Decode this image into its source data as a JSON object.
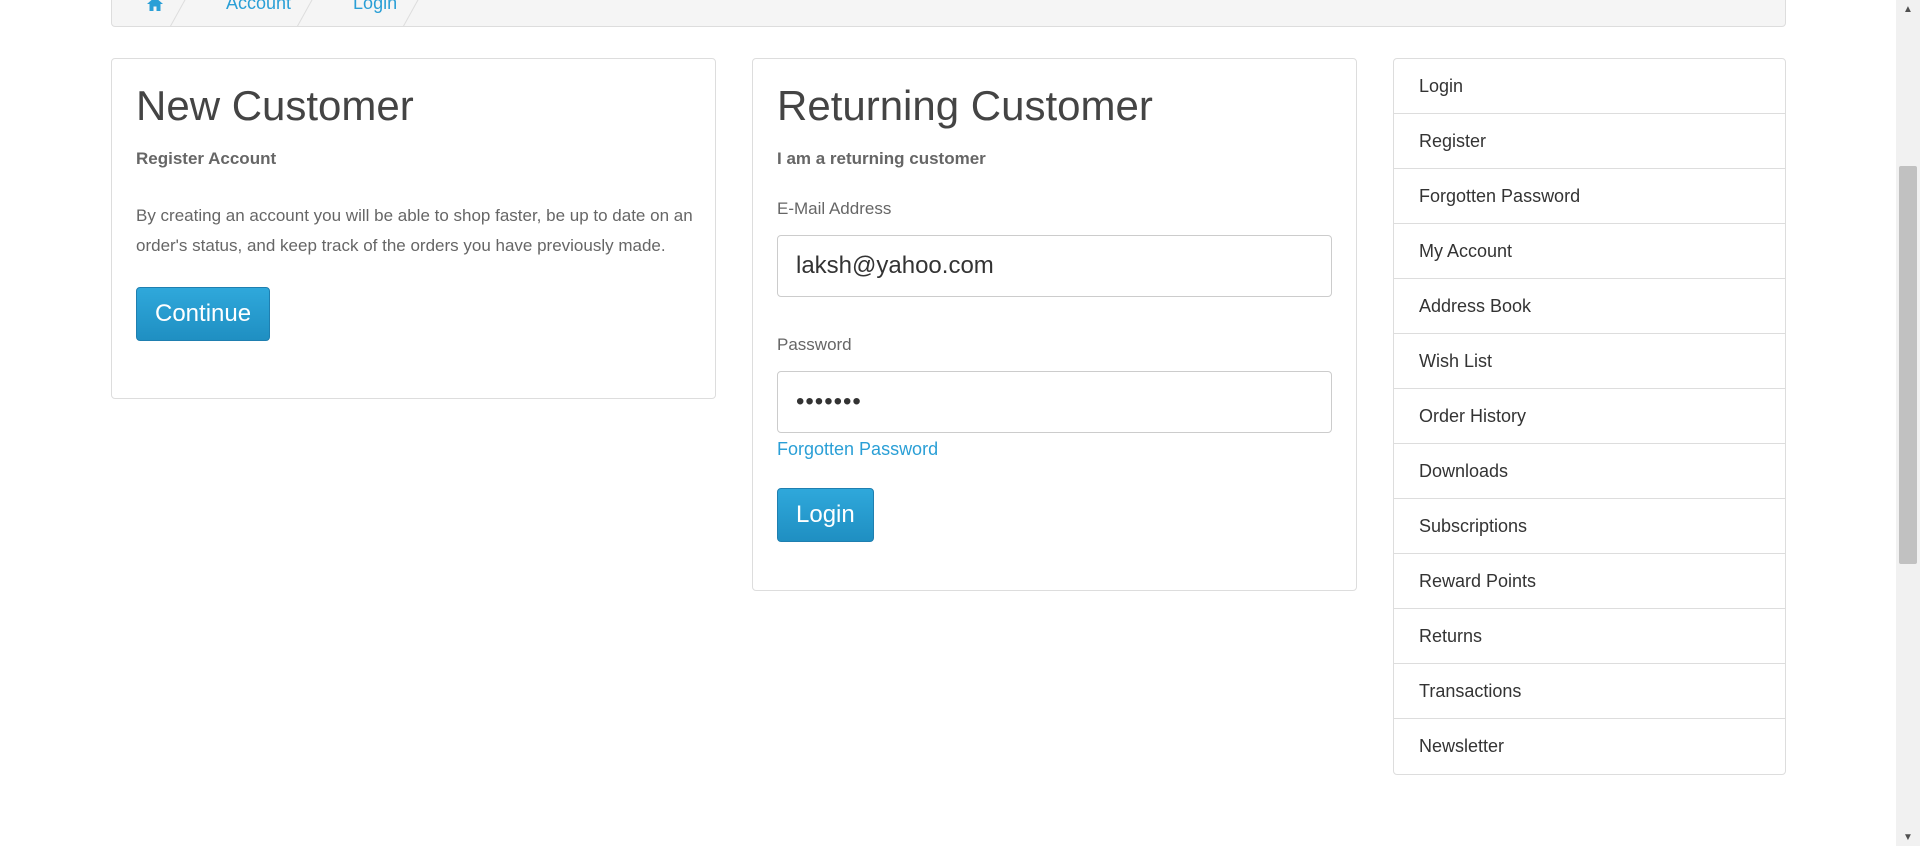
{
  "breadcrumb": {
    "home_icon": "home-icon",
    "items": [
      "Account",
      "Login"
    ]
  },
  "new_customer": {
    "title": "New Customer",
    "subtitle": "Register Account",
    "description": "By creating an account you will be able to shop faster, be up to date on an order's status, and keep track of the orders you have previously made.",
    "continue_label": "Continue"
  },
  "returning_customer": {
    "title": "Returning Customer",
    "subtitle": "I am a returning customer",
    "email_label": "E-Mail Address",
    "email_value": "laksh@yahoo.com",
    "password_label": "Password",
    "password_value": "•••••••",
    "forgotten_link": "Forgotten Password",
    "login_label": "Login"
  },
  "sidebar": {
    "items": [
      "Login",
      "Register",
      "Forgotten Password",
      "My Account",
      "Address Book",
      "Wish List",
      "Order History",
      "Downloads",
      "Subscriptions",
      "Reward Points",
      "Returns",
      "Transactions",
      "Newsletter"
    ]
  },
  "colors": {
    "accent": "#2a9fd6",
    "button": "#1f8fc2"
  }
}
